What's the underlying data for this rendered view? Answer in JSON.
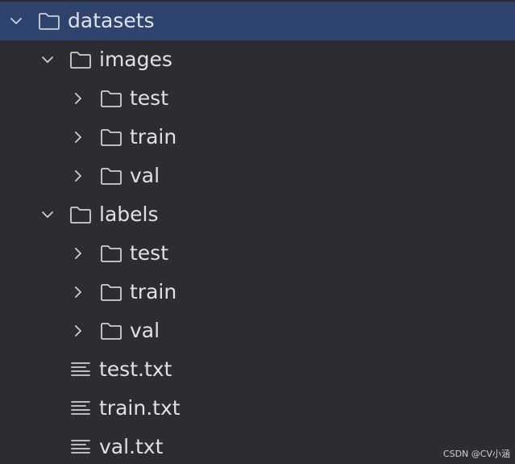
{
  "tree": {
    "root": {
      "label": "datasets",
      "expanded": true,
      "selected": true,
      "icon": "folder-icon"
    },
    "images": {
      "label": "images",
      "expanded": true,
      "icon": "folder-icon"
    },
    "images_test": {
      "label": "test",
      "expanded": false,
      "icon": "folder-icon"
    },
    "images_train": {
      "label": "train",
      "expanded": false,
      "icon": "folder-icon"
    },
    "images_val": {
      "label": "val",
      "expanded": false,
      "icon": "folder-icon"
    },
    "labels": {
      "label": "labels",
      "expanded": true,
      "icon": "folder-icon"
    },
    "labels_test": {
      "label": "test",
      "expanded": false,
      "icon": "folder-icon"
    },
    "labels_train": {
      "label": "train",
      "expanded": false,
      "icon": "folder-icon"
    },
    "labels_val": {
      "label": "val",
      "expanded": false,
      "icon": "folder-icon"
    },
    "file_test": {
      "label": "test.txt",
      "icon": "text-file-icon"
    },
    "file_train": {
      "label": "train.txt",
      "icon": "text-file-icon"
    },
    "file_val": {
      "label": "val.txt",
      "icon": "text-file-icon"
    }
  },
  "watermark": "CSDN @CV小涵",
  "colors": {
    "background": "#2b2d30",
    "selection": "#2e436e",
    "text": "#dfe1e5",
    "icon": "#ced0d6"
  }
}
